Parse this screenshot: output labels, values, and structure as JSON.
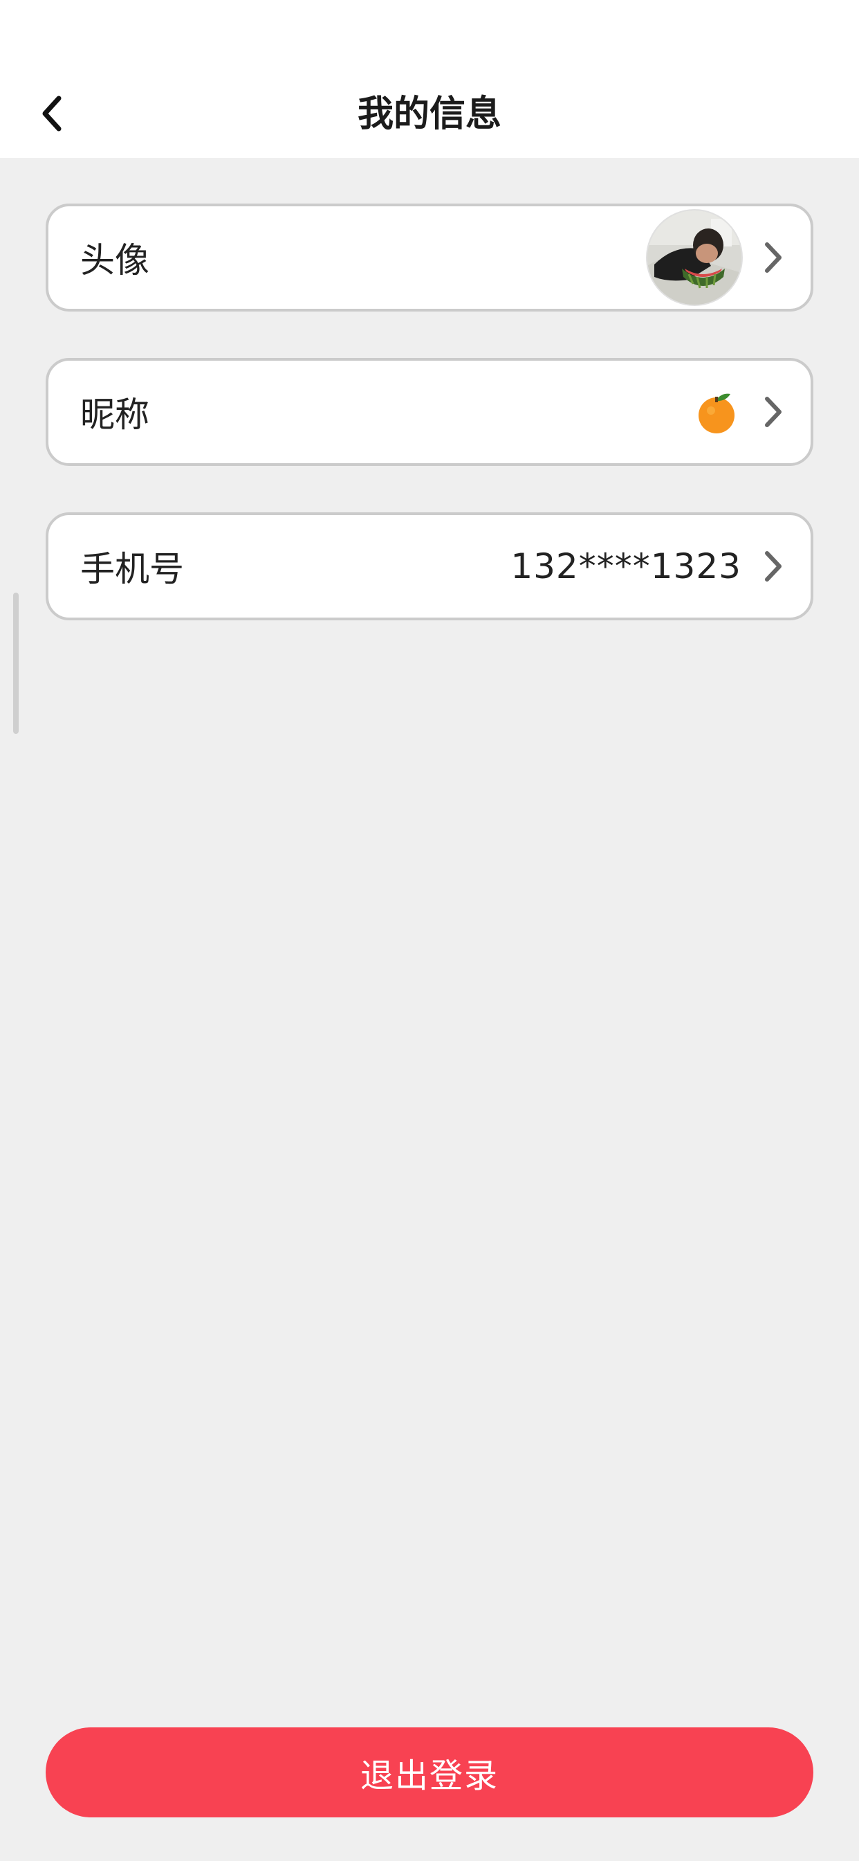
{
  "header": {
    "title": "我的信息",
    "back_icon": "chevron-left-icon"
  },
  "rows": {
    "avatar": {
      "label": "头像",
      "value_icon": "avatar-photo",
      "chevron_icon": "chevron-right-icon"
    },
    "nickname": {
      "label": "昵称",
      "value": "🍊",
      "chevron_icon": "chevron-right-icon"
    },
    "phone": {
      "label": "手机号",
      "value": "132****1323",
      "chevron_icon": "chevron-right-icon"
    }
  },
  "logout": {
    "label": "退出登录"
  },
  "colors": {
    "background": "#efefef",
    "card": "#ffffff",
    "card_border": "#cbcbcb",
    "accent": "#f84252",
    "text": "#222222",
    "chevron": "#666666"
  }
}
